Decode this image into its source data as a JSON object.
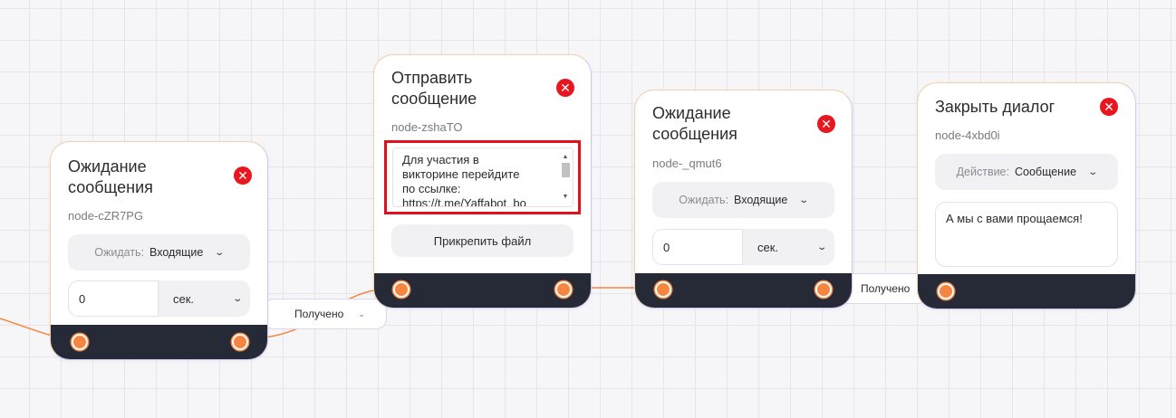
{
  "nodes": [
    {
      "title_line1": "Ожидание",
      "title_line2": "сообщения",
      "id": "node-cZR7PG",
      "wait_label": "Ожидать:",
      "wait_value": "Входящие",
      "delay_value": "0",
      "delay_unit": "сек."
    },
    {
      "title_line1": "Отправить",
      "title_line2": "сообщение",
      "id": "node-zshaTO",
      "message_lines": [
        "Для участия в",
        "викторине перейдите",
        "по ссылке:",
        "https://t.me/Yaffabot_bo"
      ],
      "attach_label": "Прикрепить файл"
    },
    {
      "title_line1": "Ожидание",
      "title_line2": "сообщения",
      "id": "node-_qmut6",
      "wait_label": "Ожидать:",
      "wait_value": "Входящие",
      "delay_value": "0",
      "delay_unit": "сек."
    },
    {
      "title": "Закрыть диалог",
      "id": "node-4xbd0i",
      "action_label": "Действие:",
      "action_value": "Сообщение",
      "message": "А мы с вами прощаемся!"
    }
  ],
  "edge_labels": [
    "Получено",
    "Получено"
  ],
  "icons": {
    "close": "close-icon",
    "chevron": "chevron-down-icon"
  },
  "colors": {
    "port": "#f5853f",
    "footer": "#262a36",
    "close": "#e8161f",
    "highlight": "#e3101b"
  }
}
